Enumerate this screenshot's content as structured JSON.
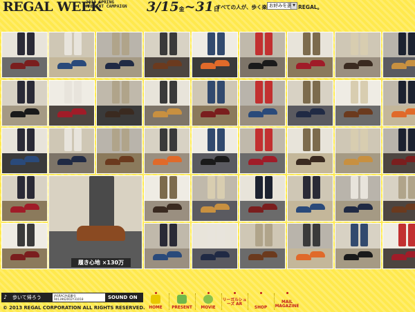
{
  "header": {
    "logo": "REGAL WEEK",
    "campaign_line1": "2013 SPRING",
    "campaign_line2": "PRESENT CAMPAIGN",
    "dates_main": "3/15",
    "dates_dow1": "金",
    "dates_sep": "~",
    "dates_end": "31",
    "dates_dow2": "日",
    "tagline": "すべての人が、歩く楽しさを・・・REGAL。",
    "lang_select": "お好みを選ぶ"
  },
  "caption": "履き心地 ×130万",
  "player": {
    "song": "歩いて帰ろう",
    "jasrac_line1": "JASRAC許諾番号",
    "jasrac_line2": "9013962002Y31018",
    "sound": "SOUND ON"
  },
  "copyright": "© 2013 REGAL CORPORATION ALL RIGHTS RESERVED.",
  "nav": [
    {
      "label": "HOME",
      "icon": "home-icon",
      "color": "#e8c800"
    },
    {
      "label": "PRESENT",
      "icon": "present-icon",
      "color": "#6fb84a"
    },
    {
      "label": "MOVIE",
      "icon": "movie-icon",
      "color": "#8ac24a"
    },
    {
      "label": "リーガルシューズ AR",
      "icon": "ar-icon",
      "color": "#ffe94d"
    },
    {
      "label": "SHOP",
      "icon": "shop-icon",
      "color": "#ffe94d"
    },
    {
      "label": "MAIL MAGAZINE",
      "icon": "mail-icon",
      "color": "#ffe94d"
    }
  ],
  "colors": {
    "background": "#ffe94d",
    "nav_text": "#c21a1a"
  }
}
